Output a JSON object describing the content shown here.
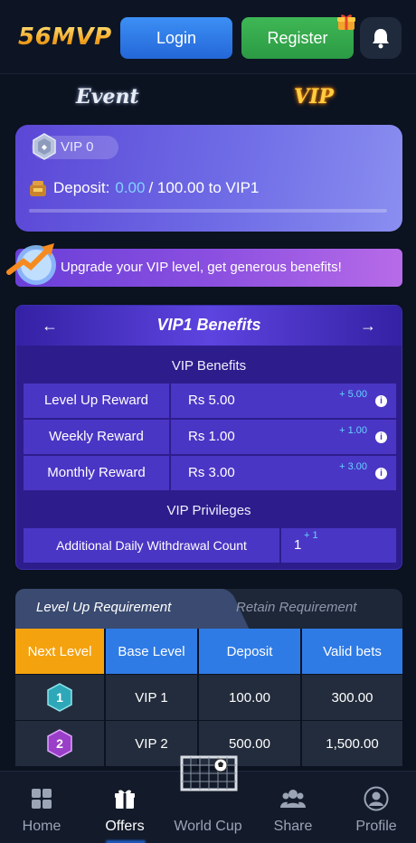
{
  "header": {
    "logo": "56MVP",
    "login_label": "Login",
    "register_label": "Register"
  },
  "page_tabs": [
    "Event",
    "VIP"
  ],
  "vip_card": {
    "level": "VIP 0",
    "deposit_label": "Deposit:",
    "current": "0.00",
    "target": "/ 100.00 to VIP1",
    "progress": 0
  },
  "upgrade_text": "Upgrade your VIP level, get generous benefits!",
  "benefits": {
    "title": "VIP1 Benefits",
    "section1": "VIP Benefits",
    "rows": [
      {
        "label": "Level Up Reward",
        "value": "Rs 5.00",
        "plus": "+ 5.00"
      },
      {
        "label": "Weekly Reward",
        "value": "Rs 1.00",
        "plus": "+ 1.00"
      },
      {
        "label": "Monthly Reward",
        "value": "Rs 3.00",
        "plus": "+ 3.00"
      }
    ],
    "section2": "VIP Privileges",
    "privilege": {
      "label": "Additional Daily Withdrawal Count",
      "value": "1",
      "plus": "+ 1"
    }
  },
  "req_tabs": [
    "Level Up Requirement",
    "Retain Requirement"
  ],
  "table": {
    "headers": [
      "Next Level",
      "Base Level",
      "Deposit",
      "Valid bets"
    ],
    "rows": [
      {
        "badge": "1",
        "base": "VIP 1",
        "deposit": "100.00",
        "bets": "300.00"
      },
      {
        "badge": "2",
        "base": "VIP 2",
        "deposit": "500.00",
        "bets": "1,500.00"
      }
    ]
  },
  "nav": [
    "Home",
    "Offers",
    "World Cup",
    "Share",
    "Profile"
  ],
  "colors": {
    "accent_blue": "#2f7be6",
    "accent_orange": "#f5a20f",
    "purple": "#4a36c4"
  }
}
